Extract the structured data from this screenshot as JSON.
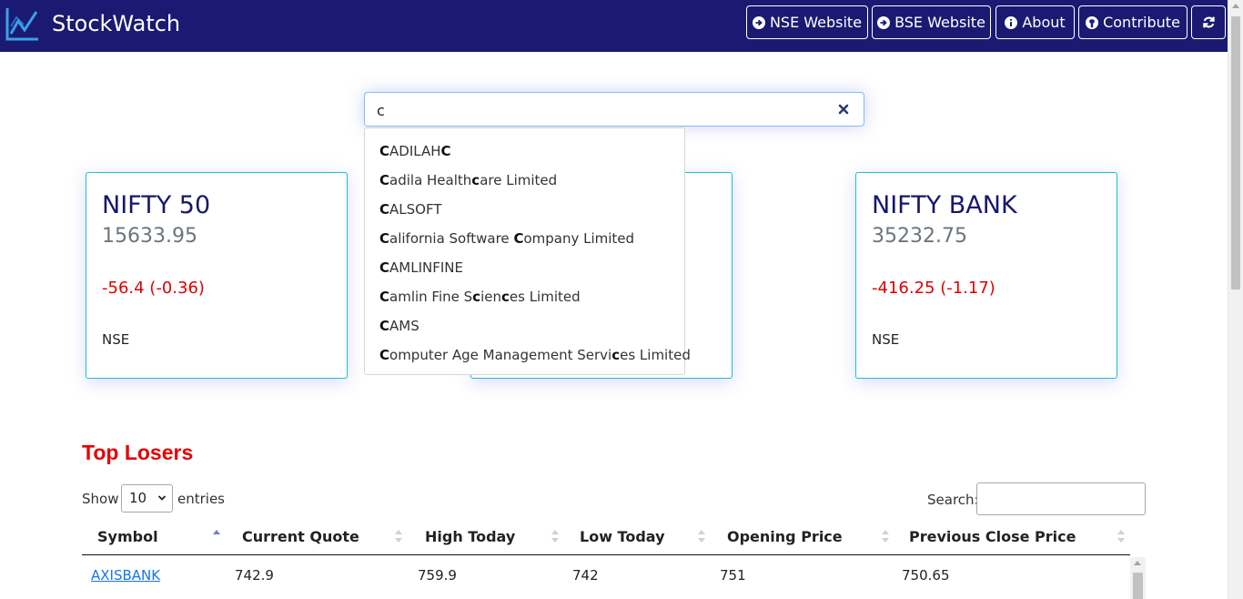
{
  "app": {
    "name": "StockWatch"
  },
  "nav": {
    "nse_label": "NSE Website",
    "bse_label": "BSE Website",
    "about_label": "About",
    "contribute_label": "Contribute"
  },
  "search": {
    "value": "c",
    "suggestions": [
      {
        "parts": [
          [
            "C",
            true
          ],
          [
            "ADILAH",
            false
          ],
          [
            "C",
            true
          ]
        ]
      },
      {
        "parts": [
          [
            "C",
            true
          ],
          [
            "adila Health",
            false
          ],
          [
            "c",
            true
          ],
          [
            "are Limited",
            false
          ]
        ]
      },
      {
        "parts": [
          [
            "C",
            true
          ],
          [
            "ALSOFT",
            false
          ]
        ]
      },
      {
        "parts": [
          [
            "C",
            true
          ],
          [
            "alifornia Software ",
            false
          ],
          [
            "C",
            true
          ],
          [
            "ompany Limited",
            false
          ]
        ]
      },
      {
        "parts": [
          [
            "C",
            true
          ],
          [
            "AMLINFINE",
            false
          ]
        ]
      },
      {
        "parts": [
          [
            "C",
            true
          ],
          [
            "amlin Fine S",
            false
          ],
          [
            "c",
            true
          ],
          [
            "ien",
            false
          ],
          [
            "c",
            true
          ],
          [
            "es Limited",
            false
          ]
        ]
      },
      {
        "parts": [
          [
            "C",
            true
          ],
          [
            "AMS",
            false
          ]
        ]
      },
      {
        "parts": [
          [
            "C",
            true
          ],
          [
            "omputer Age Management Servi",
            false
          ],
          [
            "c",
            true
          ],
          [
            "es Limited",
            false
          ]
        ]
      }
    ]
  },
  "cards": [
    {
      "title": "NIFTY 50",
      "value": "15633.95",
      "change": "-56.4 (-0.36)",
      "exchange": "NSE"
    },
    {
      "title": "",
      "value": "",
      "change": "",
      "exchange": ""
    },
    {
      "title": "NIFTY BANK",
      "value": "35232.75",
      "change": "-416.25 (-1.17)",
      "exchange": "NSE"
    }
  ],
  "losers": {
    "title": "Top Losers",
    "show_label": "Show",
    "length_value": "10",
    "entries_label": "entries",
    "search_label": "Search:",
    "columns": [
      "Symbol",
      "Current Quote",
      "High Today",
      "Low Today",
      "Opening Price",
      "Previous Close Price"
    ],
    "rows": [
      [
        "AXISBANK",
        "742.9",
        "759.9",
        "742",
        "751",
        "750.65"
      ]
    ]
  },
  "colors": {
    "navbar": "#1a1a73",
    "card_border": "#17c0d6",
    "negative": "#e00000",
    "section_title": "#e60000"
  }
}
